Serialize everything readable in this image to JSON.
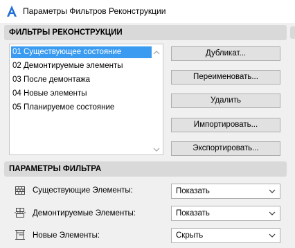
{
  "window": {
    "title": "Параметры Фильтров Реконструкции",
    "icon": "archicad-logo-icon"
  },
  "filters_section": {
    "header": "ФИЛЬТРЫ РЕКОНСТРУКЦИИ",
    "items": [
      {
        "label": "01 Существующее состояние",
        "selected": true
      },
      {
        "label": "02 Демонтируемые элементы",
        "selected": false
      },
      {
        "label": "03 После демонтажа",
        "selected": false
      },
      {
        "label": "04 Новые элементы",
        "selected": false
      },
      {
        "label": "05 Планируемое состояние",
        "selected": false
      }
    ],
    "buttons": {
      "duplicate": "Дубликат...",
      "rename": "Переименовать...",
      "delete": "Удалить",
      "import": "Импортировать...",
      "export": "Экспортировать..."
    }
  },
  "params_section": {
    "header": "ПАРАМЕТРЫ ФИЛЬТРА",
    "rows": [
      {
        "label": "Существующие Элементы:",
        "value": "Показать",
        "icon": "brick-wall-icon"
      },
      {
        "label": "Демонтируемые Элементы:",
        "value": "Показать",
        "icon": "demolish-icon"
      },
      {
        "label": "Новые Элементы:",
        "value": "Скрыть",
        "icon": "new-element-icon"
      }
    ]
  },
  "colors": {
    "selection": "#3a9bf0",
    "header_bg": "#d9d9d9",
    "window_bg": "#f0f0f0"
  }
}
